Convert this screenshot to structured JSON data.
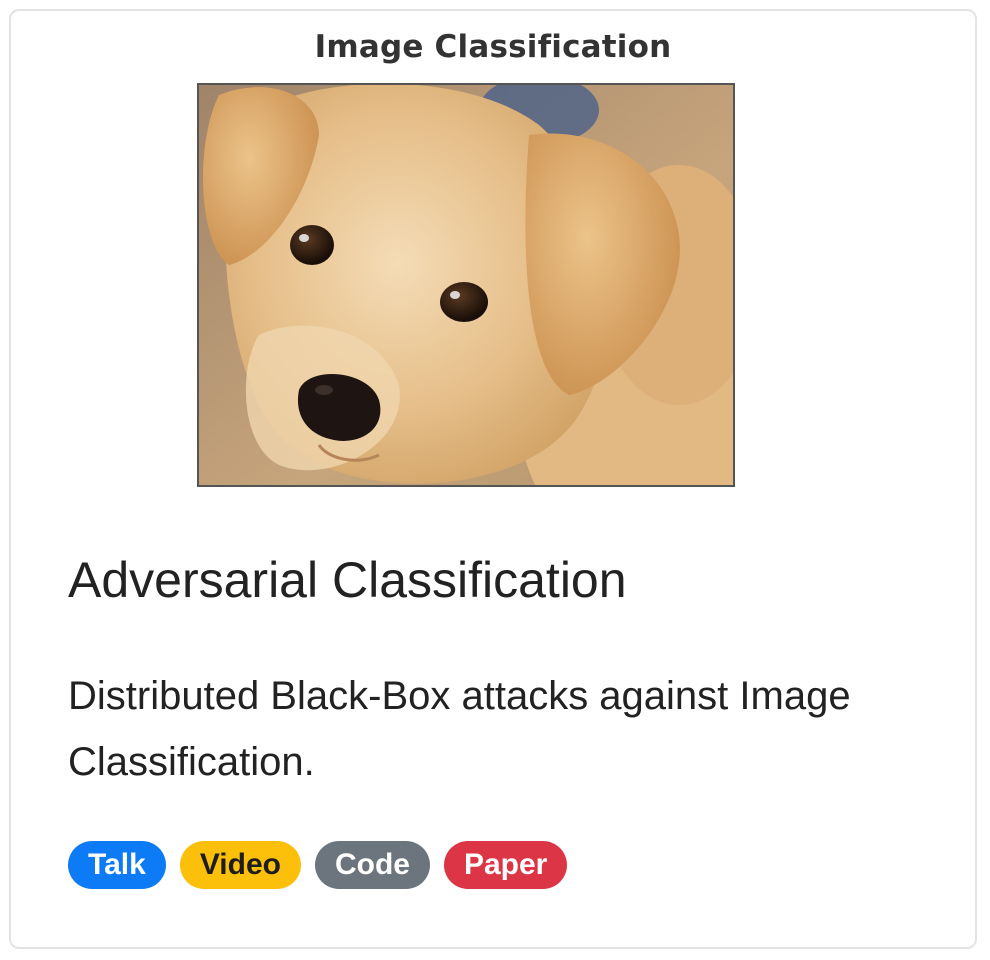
{
  "card": {
    "category": "Image Classification",
    "image": {
      "icon": "puppy-photo",
      "description": "golden retriever puppy close-up"
    },
    "title": "Adversarial Classification",
    "description": "Distributed Black-Box attacks against Image Classification.",
    "tags": [
      {
        "label": "Talk",
        "color": "#0d7bf5"
      },
      {
        "label": "Video",
        "color": "#fcbf0a"
      },
      {
        "label": "Code",
        "color": "#6c757d"
      },
      {
        "label": "Paper",
        "color": "#dc3545"
      }
    ]
  }
}
